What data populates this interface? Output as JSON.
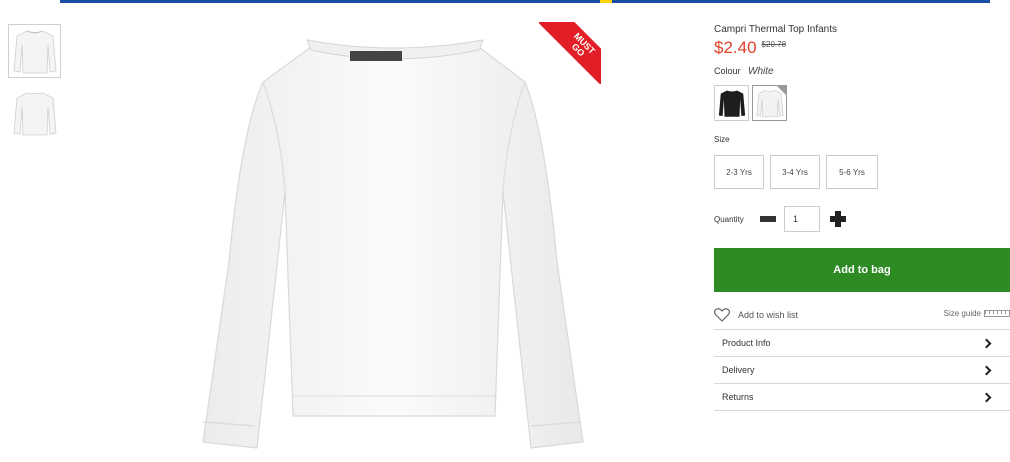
{
  "product": {
    "title": "Campri Thermal Top Infants",
    "price": "$2.40",
    "old_price": "$20.78",
    "badge": "MUST GO"
  },
  "colour": {
    "label": "Colour",
    "selected": "White",
    "options": [
      "Black",
      "White"
    ]
  },
  "size": {
    "label": "Size",
    "options": [
      "2-3 Yrs",
      "3-4 Yrs",
      "5-6 Yrs"
    ]
  },
  "quantity": {
    "label": "Quantity",
    "value": "1"
  },
  "actions": {
    "add_to_bag": "Add to bag",
    "wish_list": "Add to wish list",
    "size_guide": "Size guide"
  },
  "accordion": [
    "Product Info",
    "Delivery",
    "Returns"
  ],
  "colors": {
    "accent_red": "#e0402a",
    "badge_red": "#e41e26",
    "button_green": "#2e8b24",
    "top_bar_blue": "#1a4fa3"
  }
}
